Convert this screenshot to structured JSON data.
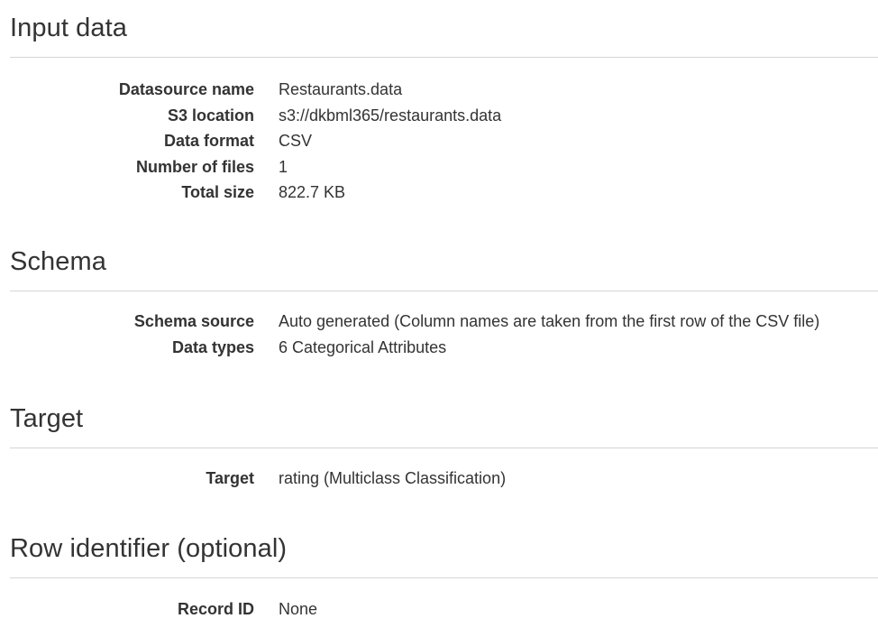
{
  "sections": {
    "input_data": {
      "title": "Input data",
      "rows": [
        {
          "label": "Datasource name",
          "value": "Restaurants.data"
        },
        {
          "label": "S3 location",
          "value": "s3://dkbml365/restaurants.data"
        },
        {
          "label": "Data format",
          "value": "CSV"
        },
        {
          "label": "Number of files",
          "value": "1"
        },
        {
          "label": "Total size",
          "value": "822.7 KB"
        }
      ]
    },
    "schema": {
      "title": "Schema",
      "rows": [
        {
          "label": "Schema source",
          "value": "Auto generated (Column names are taken from the first row of the CSV file)"
        },
        {
          "label": "Data types",
          "value": "6 Categorical Attributes"
        }
      ]
    },
    "target": {
      "title": "Target",
      "rows": [
        {
          "label": "Target",
          "value": "rating (Multiclass Classification)"
        }
      ]
    },
    "row_identifier": {
      "title": "Row identifier (optional)",
      "rows": [
        {
          "label": "Record ID",
          "value": "None"
        }
      ]
    }
  }
}
